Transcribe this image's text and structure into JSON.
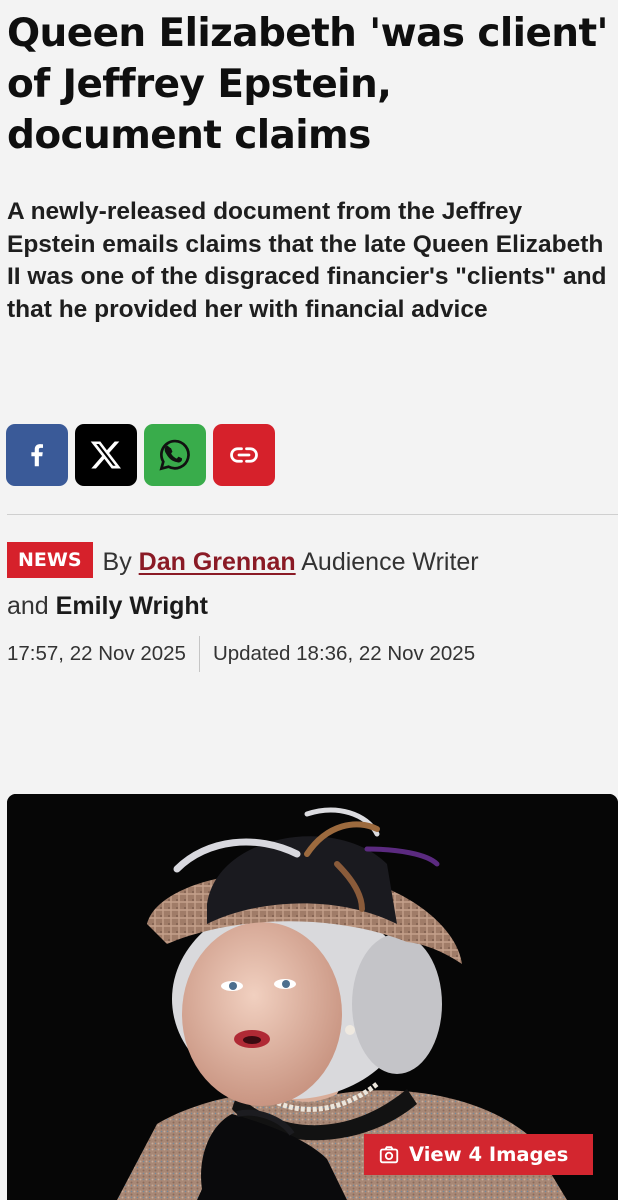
{
  "article": {
    "headline": "Queen Elizabeth 'was client' of Jeffrey Epstein, document claims",
    "standfirst": "A newly-released document from the Jeffrey Epstein emails claims that the late Queen Elizabeth II was one of the disgraced financier's \"clients\" and that he provided her with financial advice"
  },
  "share": {
    "buttons": [
      {
        "icon": "facebook-icon",
        "color": "#3a5a98"
      },
      {
        "icon": "x-icon",
        "color": "#000000"
      },
      {
        "icon": "whatsapp-icon",
        "color": "#39ac4b"
      },
      {
        "icon": "link-icon",
        "color": "#d6212b"
      }
    ]
  },
  "byline": {
    "tag": "NEWS",
    "by": "By",
    "author1": "Dan Grennan",
    "author1_role": "Audience Writer",
    "and": "and",
    "author2": "Emily Wright"
  },
  "dates": {
    "published": "17:57, 22 Nov 2025",
    "updated": "Updated 18:36, 22 Nov 2025"
  },
  "media": {
    "view_images_label": "View 4 Images",
    "icon": "camera-icon"
  },
  "colors": {
    "accent": "#d6212b",
    "author_link": "#8a1a25",
    "background": "#f3f3f3"
  }
}
